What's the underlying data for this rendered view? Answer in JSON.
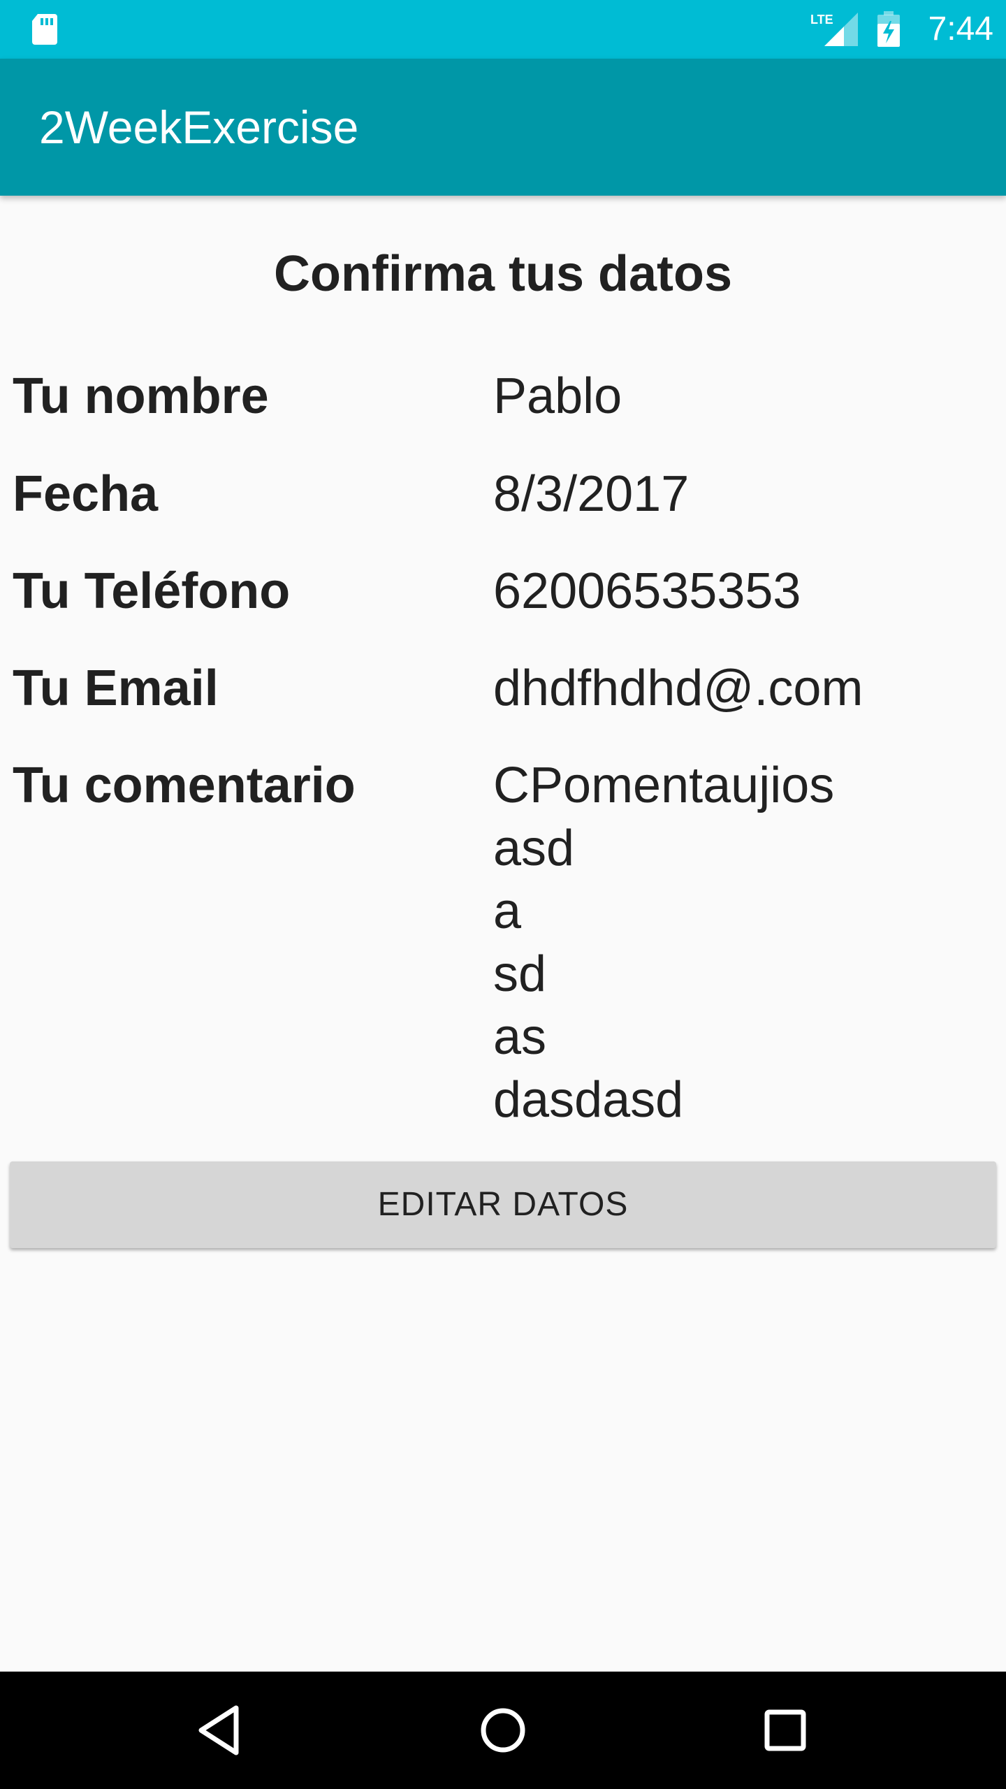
{
  "status_bar": {
    "network_label": "LTE",
    "time": "7:44",
    "icons": [
      "sd-card-icon",
      "lte-signal-icon",
      "battery-charging-icon"
    ]
  },
  "app_bar": {
    "title": "2WeekExercise"
  },
  "screen": {
    "heading": "Confirma tus datos",
    "fields": [
      {
        "label": "Tu nombre",
        "value": "Pablo"
      },
      {
        "label": "Fecha",
        "value": "8/3/2017"
      },
      {
        "label": "Tu Teléfono",
        "value": "62006535353"
      },
      {
        "label": "Tu Email",
        "value": "dhdfhdhd@.com"
      },
      {
        "label": "Tu comentario",
        "value_lines": [
          "CPomentaujios",
          "asd",
          "a",
          "sd",
          "as",
          "dasdasd"
        ]
      }
    ],
    "edit_button_label": "EDITAR DATOS"
  },
  "nav_bar": {
    "icons": [
      "back-icon",
      "home-icon",
      "recent-apps-icon"
    ]
  },
  "colors": {
    "status_bar": "#00bcd4",
    "app_bar": "#0097a7",
    "background": "#fafafa",
    "button": "#d6d6d6",
    "nav_bar": "#000000"
  }
}
